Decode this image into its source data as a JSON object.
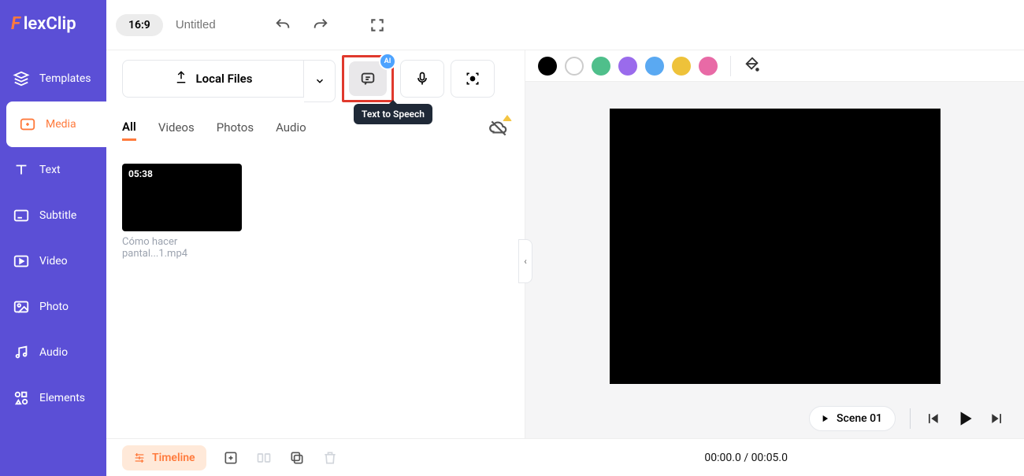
{
  "brand": {
    "f": "F",
    "rest": "lexClip"
  },
  "sidebar": {
    "items": [
      {
        "label": "Templates"
      },
      {
        "label": "Media"
      },
      {
        "label": "Text"
      },
      {
        "label": "Subtitle"
      },
      {
        "label": "Video"
      },
      {
        "label": "Photo"
      },
      {
        "label": "Audio"
      },
      {
        "label": "Elements"
      }
    ]
  },
  "topbar": {
    "aspect": "16:9",
    "title": "Untitled"
  },
  "upload": {
    "local_files": "Local Files",
    "tts_tooltip": "Text to Speech",
    "ai_badge": "AI"
  },
  "tabs": [
    "All",
    "Videos",
    "Photos",
    "Audio"
  ],
  "media": {
    "items": [
      {
        "duration": "05:38",
        "name": "Cómo hacer pantal...1.mp4"
      }
    ]
  },
  "swatches": [
    "#000000",
    "outlined",
    "#4fbf8b",
    "#9a6bec",
    "#5aa9f2",
    "#eec23a",
    "#e86aa6"
  ],
  "scene": {
    "label": "Scene 01"
  },
  "bottom": {
    "timeline": "Timeline",
    "time": "00:00.0 / 00:05.0"
  }
}
